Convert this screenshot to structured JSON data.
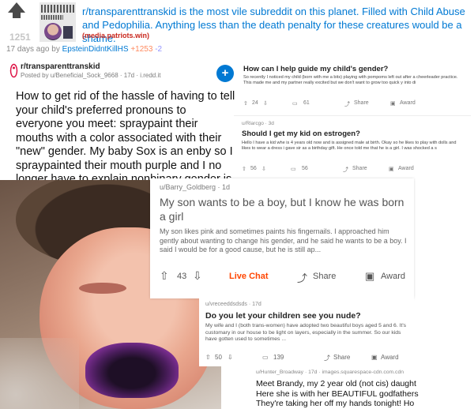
{
  "header": {
    "score": "1251",
    "title": "r/transparenttranskid is the most vile subreddit on this planet. Filled with Child Abuse and Pedophilia. Anything less than the death penalty for these creatures would be a shame.",
    "domain": "(media.patriots.win)",
    "meta_age": "17 days ago by",
    "meta_user": "EpsteinDidntKillHS",
    "meta_up": "+1253",
    "meta_down": "-2"
  },
  "card_main": {
    "subreddit": "r/transparenttranskid",
    "posted_by": "Posted by u/Beneficial_Sock_9668 · 17d · i.redd.it",
    "body": "How to get rid of the hassle of having to tell your child's preferred pronouns to everyone you meet: spraypaint their mouths with a color associated with their \"new\" gender. My baby Sox is an enby so I spraypainted their mouth purple and I no longer have to explain nonbinary gender is to people"
  },
  "card_gender": {
    "title": "How can I help guide my child's gender?",
    "snippet": "So recently I noticed my child (born with me a bits) playing with pompoms left out after a cheerleader practice. This made me and my partner really excited but we don't want to grow too quick y into di",
    "votes": "24",
    "comments": "61",
    "share": "Share",
    "award": "Award"
  },
  "card_estrogen": {
    "by": "u/Rlarcgo · 3d",
    "title": "Should I get my kid on estrogen?",
    "snippet": "Hello I have a kid whe is 4 years old now and is assigned male at birth. Okay so he likes to play with dolls and likes to wear a dress i gave sir as a birthday gift. He once told me that he is a girl. I was shocked a s",
    "votes": "56",
    "comments": "56",
    "share": "Share",
    "award": "Award"
  },
  "card_barry": {
    "by": "u/Barry_Goldberg · 1d",
    "title": "My son wants to be a boy, but I know he was born a girl",
    "snippet": "My son likes pink and sometimes paints his fingernails. I approached him gently about wanting to change his gender, and he said he wants to be a boy. I said I would be for a good cause, but he is still ap...",
    "votes": "43",
    "live_chat": "Live Chat",
    "share": "Share",
    "award": "Award"
  },
  "card_nude": {
    "by": "u/vreceeddsdsds · 17d",
    "title": "Do you let your children see you nude?",
    "snippet": "My wife and I (both trans-women) have adopted two beautiful boys aged 5 and 6. It's customary in our house to be light on layers, especially in the summer. So our kids have gotten used to sometimes ...",
    "votes": "50",
    "comments": "139",
    "share": "Share",
    "award": "Award"
  },
  "card_brandy": {
    "by": "u/Hunter_Broadway · 17d · images.squarespace-cdn.com.cdn",
    "line1": "Meet Brandy, my 2 year old (not cis) daught",
    "line2": "Here she is with her BEAUTIFUL godfathers",
    "line3": "They're taking her off my hands tonight! Ho"
  },
  "colors": {
    "link_blue": "#0079d3",
    "domain_red": "#c9261c",
    "upvote_orange": "#ff8b60",
    "downvote_blue": "#9494ff",
    "live_chat_orange": "#ff4500",
    "paint_purple": "#7e2f94"
  },
  "icons": [
    "upvote-arrow-icon",
    "downvote-arrow-icon",
    "comment-icon",
    "share-icon",
    "award-icon",
    "plus-icon"
  ]
}
